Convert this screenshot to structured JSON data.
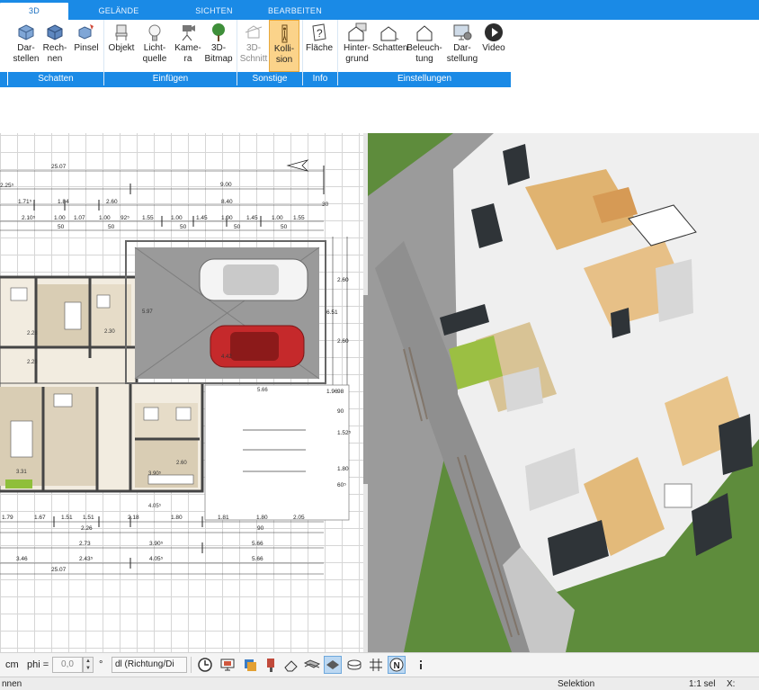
{
  "tabs": [
    {
      "label": "3D",
      "active": true
    },
    {
      "label": "GELÄNDE",
      "active": false
    },
    {
      "label": "SICHTEN",
      "active": false
    },
    {
      "label": "BEARBEITEN",
      "active": false
    }
  ],
  "ribbon": {
    "buttons": {
      "darstellen": "Dar-\nstellen",
      "rechnen": "Rech-\nnen",
      "pinsel": "Pinsel",
      "objekt": "Objekt",
      "lichtquelle": "Licht-\nquelle",
      "kamera": "Kame-\nra",
      "bitmap3d": "3D-\nBitmap",
      "schnitt3d": "3D-\nSchnitt",
      "kollision": "Kolli-\nsion",
      "flaeche": "Fläche",
      "hintergrund": "Hinter-\ngrund",
      "schatten": "Schatten",
      "beleuchtung": "Beleuch-\ntung",
      "darstellung": "Dar-\nstellung",
      "video": "Video"
    },
    "groups": {
      "schatten": "Schatten",
      "einfuegen": "Einfügen",
      "sonstige": "Sonstige",
      "info": "Info",
      "einstellungen": "Einstellungen"
    }
  },
  "plan": {
    "dims_top": [
      "25.07",
      "2.25⁵",
      "9.00",
      "1.71⁵",
      "1.84",
      "2.60",
      "8.40",
      "2.10⁵",
      "1.00",
      "1.07",
      "1.00",
      "92⁵",
      "1.55",
      "1.00",
      "1.45",
      "1.00",
      "1.45",
      "1.00",
      "1.55",
      "50",
      "50",
      "50",
      "50",
      "50",
      "30"
    ],
    "dims_bottom": [
      "1.79",
      "1.67",
      "1.51",
      "1.51",
      "2.18",
      "1.80",
      "1.81",
      "1.80",
      "2.05",
      "2.26",
      "90",
      "2.73",
      "3.90⁵",
      "5.66",
      "3.46",
      "2.43⁵",
      "4.05⁵",
      "5.66",
      "25.07"
    ],
    "dims_right": [
      "2.60",
      "2.60",
      "6.51",
      "98",
      "1.96",
      "90",
      "1.52⁵",
      "1.80",
      "60⁵"
    ],
    "room_labels": [
      "2.28",
      "2.30",
      "2.29",
      "3.31",
      "3.90⁵",
      "4.05⁵",
      "5.97",
      "4.42",
      "5.66",
      "2.60"
    ]
  },
  "inputbar": {
    "unit": "cm",
    "phi_label": "phi =",
    "phi_value": "0,0",
    "degree": "°",
    "direction": "dl (Richtung/Di"
  },
  "statusbar": {
    "left": "nnen",
    "center": "Selektion",
    "scale": "1:1 sel",
    "coord": "X:"
  },
  "colors": {
    "accent": "#1a8ae6",
    "selected_button": "#fbd38a",
    "garage_floor": "#9a9a9a",
    "grass": "#5c8a3a"
  }
}
